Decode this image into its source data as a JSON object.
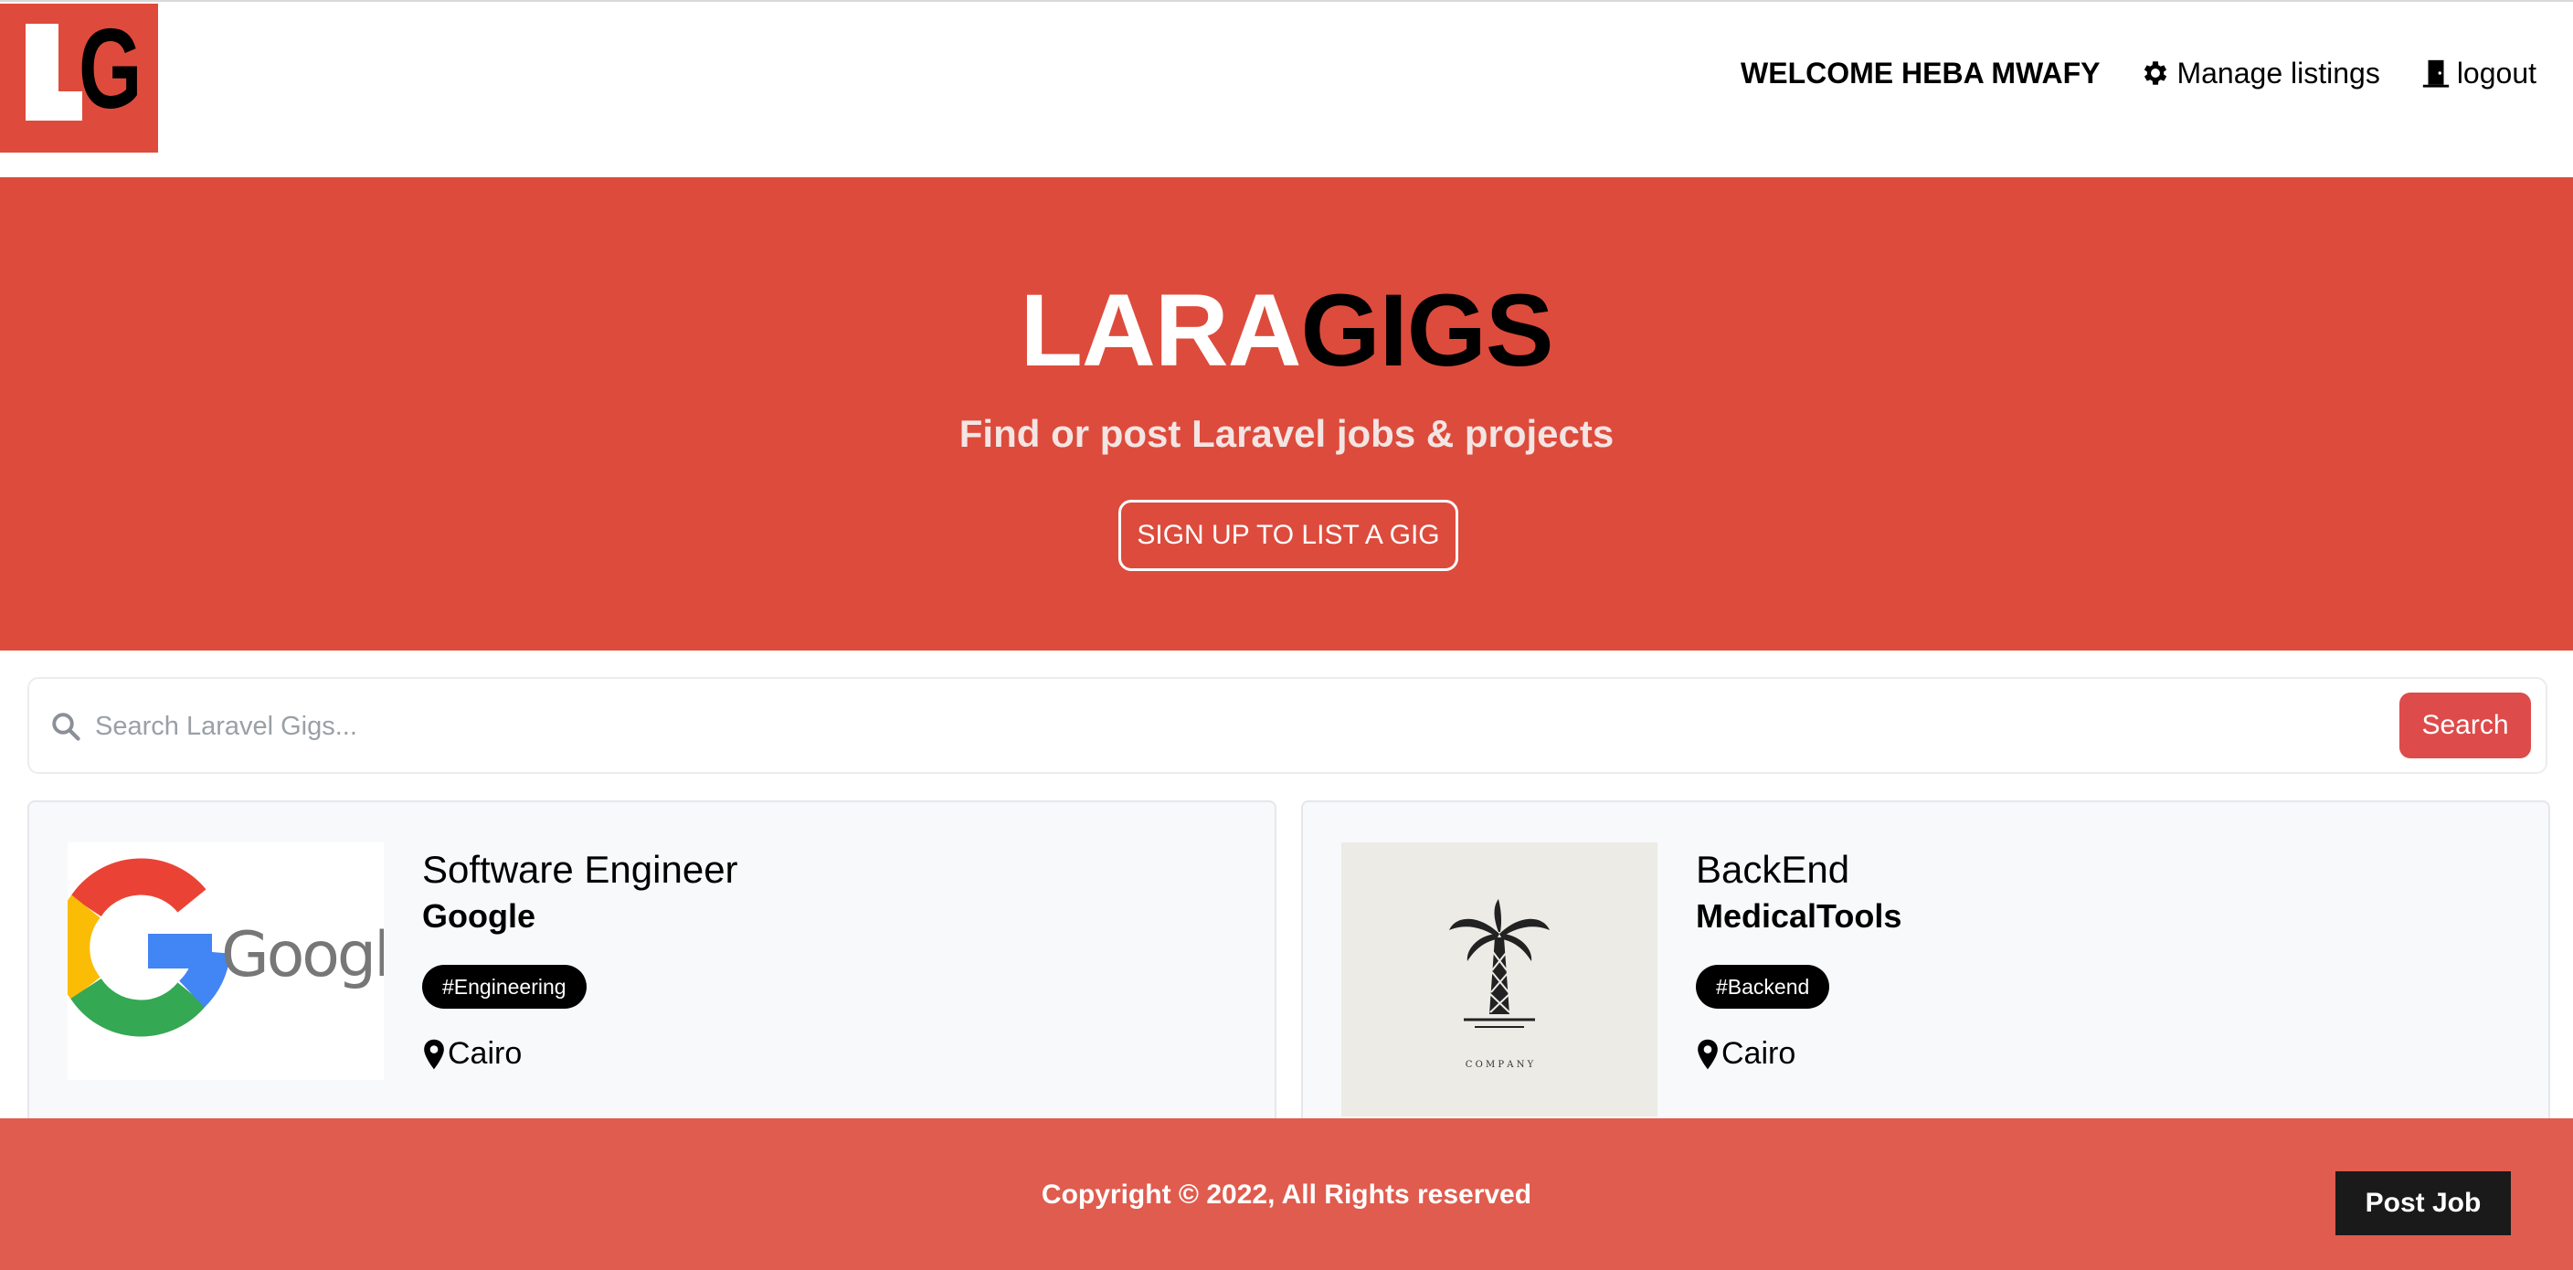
{
  "nav": {
    "logo_text": "LG",
    "welcome": "WELCOME HEBA MWAFY",
    "manage_label": "Manage listings",
    "logout_label": "logout"
  },
  "hero": {
    "title_part1": "LARA",
    "title_part2": "GIGS",
    "subtitle": "Find or post Laravel jobs & projects",
    "cta_label": "SIGN UP TO LIST A GIG"
  },
  "search": {
    "placeholder": "Search Laravel Gigs...",
    "button_label": "Search"
  },
  "listings": [
    {
      "title": "Software Engineer",
      "company": "Google",
      "tag": "#Engineering",
      "location": "Cairo",
      "logo_text": "Google"
    },
    {
      "title": "BackEnd",
      "company": "MedicalTools",
      "tag": "#Backend",
      "location": "Cairo",
      "logo_text": "C O M P A N Y"
    }
  ],
  "footer": {
    "copyright": "Copyright © 2022, All Rights reserved",
    "post_job_label": "Post Job"
  },
  "colors": {
    "brand_red": "#dd4b3c",
    "footer_red": "#e05c4e",
    "search_button": "#dd4b4b"
  }
}
